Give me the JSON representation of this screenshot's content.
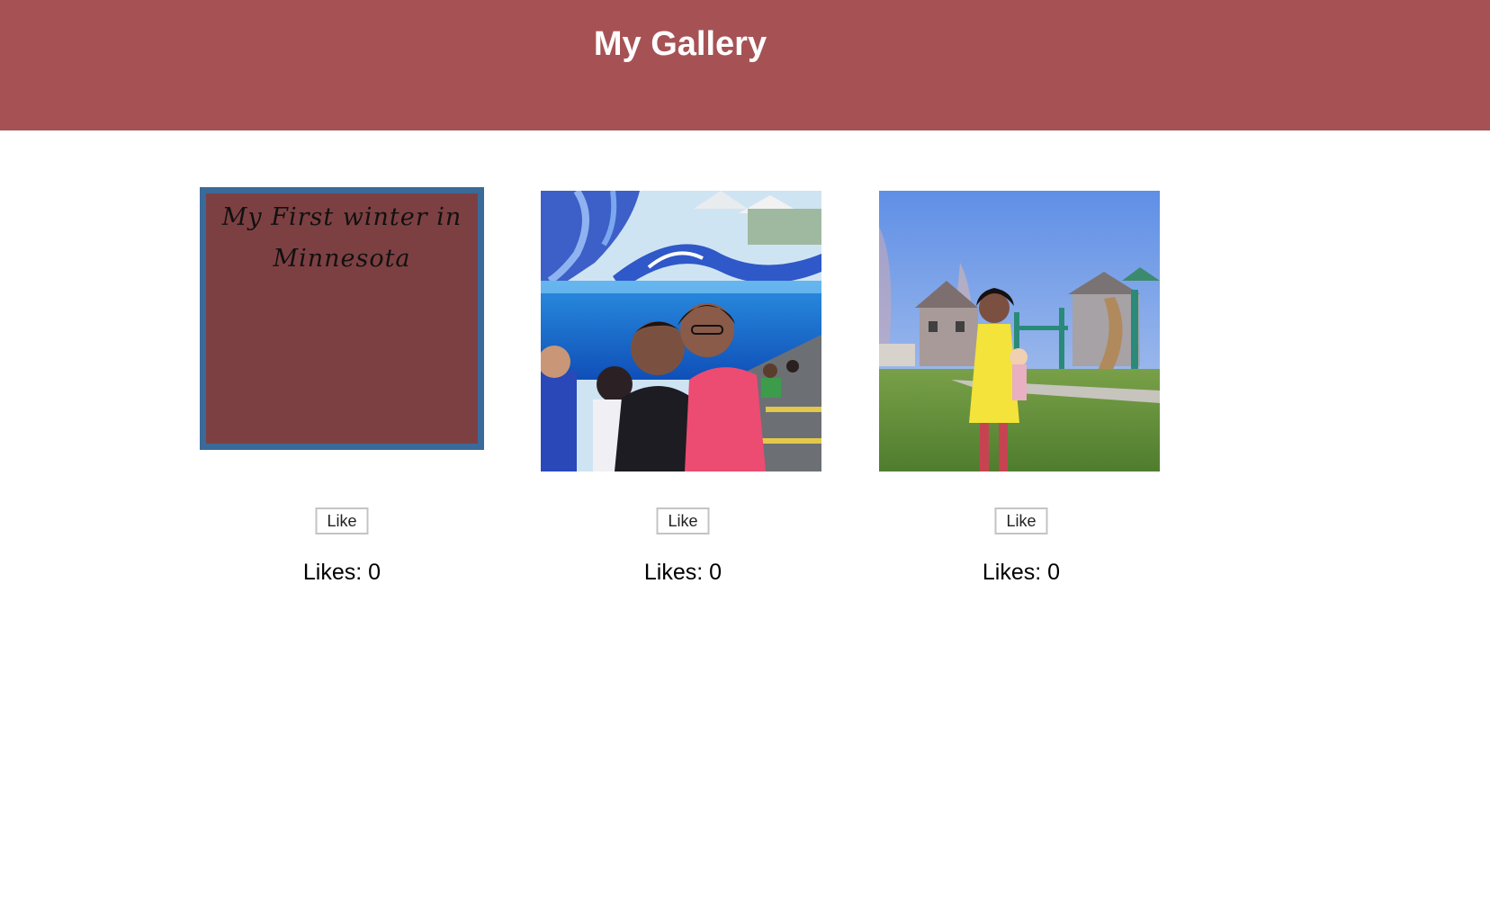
{
  "header": {
    "title": "My Gallery",
    "background_color": "#a65254"
  },
  "gallery": [
    {
      "type": "text-tile",
      "caption": "My First winter in Minnesota",
      "tile_color": "#7d4042",
      "border_color": "#3a6a9a",
      "like_label": "Like",
      "likes_label": "Likes:",
      "likes_count": "0"
    },
    {
      "type": "photo",
      "subject": "couple-at-aquarium-photo",
      "like_label": "Like",
      "likes_label": "Likes:",
      "likes_count": "0"
    },
    {
      "type": "photo",
      "subject": "child-at-playground-photo",
      "like_label": "Like",
      "likes_label": "Likes:",
      "likes_count": "0"
    }
  ]
}
